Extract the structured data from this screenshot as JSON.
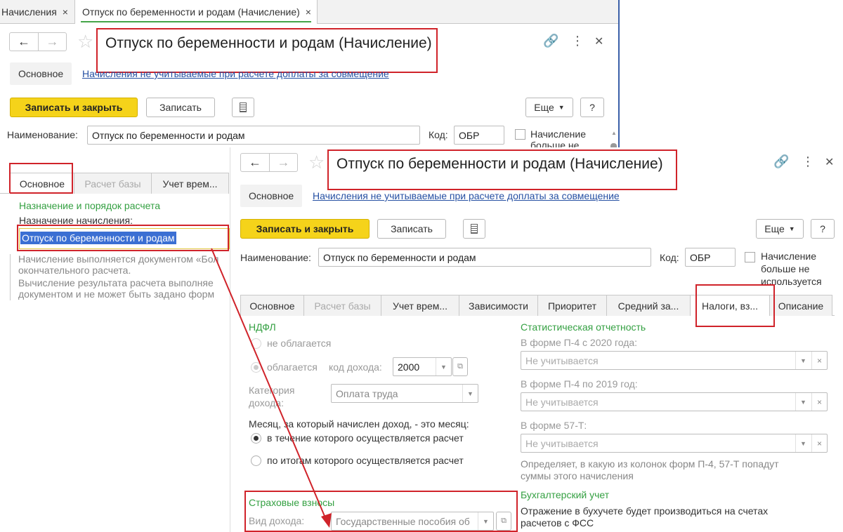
{
  "back_window": {
    "tabs": [
      {
        "label": "Начисления",
        "close": "×"
      },
      {
        "label": "Отпуск по беременности и родам (Начисление)",
        "close": "×"
      }
    ],
    "title": "Отпуск по беременности и родам (Начисление)",
    "section_main": "Основное",
    "section_link": "Начисления не учитываемые при расчете доплаты за совмещение",
    "save_close": "Записать и закрыть",
    "save": "Записать",
    "more": "Еще",
    "help": "?",
    "name_label": "Наименование:",
    "name_value": "Отпуск по беременности и родам",
    "code_label": "Код:",
    "code_value": "ОБР",
    "not_used_1": "Начисление",
    "not_used_2": "больше не",
    "form_tabs": [
      "Основное",
      "Расчет базы",
      "Учет врем..."
    ],
    "purpose_heading": "Назначение и порядок расчета",
    "purpose_label": "Назначение начисления:",
    "purpose_value": "Отпуск по беременности и родам",
    "desc_lines": [
      "Начисление выполняется документом «Бол",
      "окончательного расчета.",
      "Вычисление результата расчета выполняе",
      "документом и не может быть задано форм"
    ]
  },
  "front_window": {
    "title": "Отпуск по беременности и родам (Начисление)",
    "section_main": "Основное",
    "section_link": "Начисления не учитываемые при расчете доплаты за совмещение",
    "save_close": "Записать и закрыть",
    "save": "Записать",
    "more": "Еще",
    "help": "?",
    "name_label": "Наименование:",
    "name_value": "Отпуск по беременности и родам",
    "code_label": "Код:",
    "code_value": "ОБР",
    "not_used": [
      "Начисление",
      "больше не",
      "используется"
    ],
    "form_tabs": [
      "Основное",
      "Расчет базы",
      "Учет врем...",
      "Зависимости",
      "Приоритет",
      "Средний за...",
      "Налоги, вз...",
      "Описание"
    ],
    "ndfl": {
      "heading": "НДФЛ",
      "not_taxed": "не облагается",
      "taxed": "облагается",
      "income_code_label": "код дохода:",
      "income_code_value": "2000",
      "category_label_1": "Категория",
      "category_label_2": "дохода:",
      "category_value": "Оплата труда",
      "month_label": "Месяц, за который начислен доход, - это месяц:",
      "month_option_1": "в течение которого осуществляется расчет",
      "month_option_2": "по итогам которого осуществляется расчет"
    },
    "insurance": {
      "heading": "Страховые взносы",
      "income_type_label": "Вид дохода:",
      "income_type_value": "Государственные пособия об"
    },
    "stats": {
      "heading": "Статистическая отчетность",
      "p4_2020_label": "В форме П-4 с 2020 года:",
      "p4_2020_value": "Не учитывается",
      "p4_2019_label": "В форме П-4 по 2019 год:",
      "p4_2019_value": "Не учитывается",
      "f57t_label": "В форме 57-Т:",
      "f57t_value": "Не учитывается",
      "hint_1": "Определяет, в какую из колонок форм П-4, 57-Т попадут",
      "hint_2": "суммы этого начисления"
    },
    "accounting": {
      "heading": "Бухгалтерский учет",
      "text_1": "Отражение в бухучете будет производиться на счетах",
      "text_2": "расчетов с ФСС"
    }
  },
  "colors": {
    "accent_green": "#34a042",
    "button_yellow": "#f5d31a",
    "callout_red": "#d0232a",
    "link_blue": "#2650a3"
  }
}
